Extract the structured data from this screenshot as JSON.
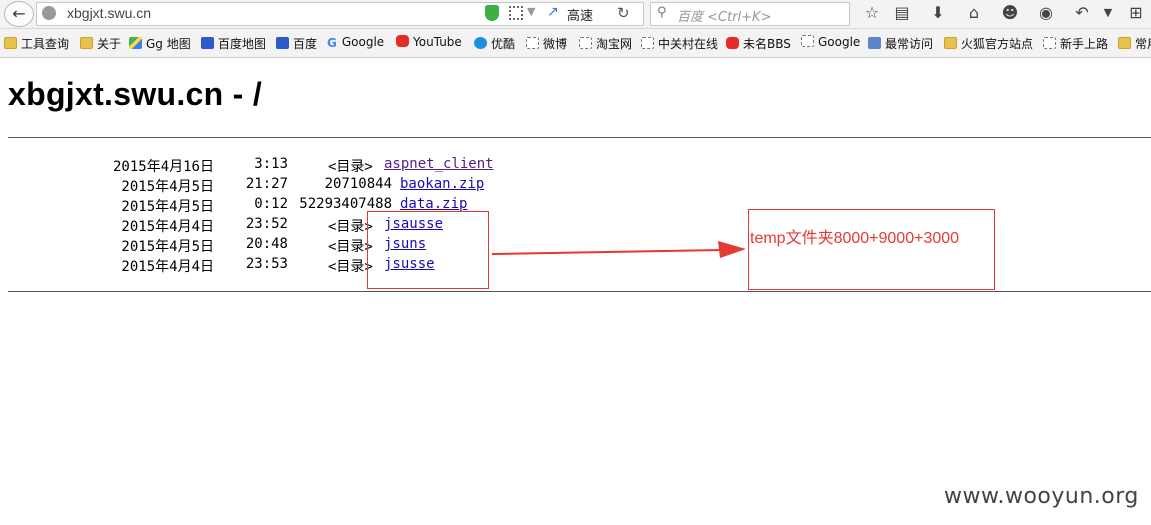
{
  "toolbar": {
    "url": "xbgjxt.swu.cn",
    "speed_label": "高速",
    "search_placeholder": "百度 <Ctrl+K>"
  },
  "bookmarks": [
    {
      "label": "工具查询",
      "icon": "folder"
    },
    {
      "label": "关于",
      "icon": "folder"
    },
    {
      "label": "Gg 地图",
      "icon": "maps"
    },
    {
      "label": "百度地图",
      "icon": "paw"
    },
    {
      "label": "百度",
      "icon": "paw"
    },
    {
      "label": "Google",
      "icon": "gg"
    },
    {
      "label": "YouTube",
      "icon": "yt"
    },
    {
      "label": "优酷",
      "icon": "yk"
    },
    {
      "label": "微博",
      "icon": "page"
    },
    {
      "label": "淘宝网",
      "icon": "page"
    },
    {
      "label": "中关村在线",
      "icon": "page"
    },
    {
      "label": "未名BBS",
      "icon": "yt"
    },
    {
      "label": "Google",
      "icon": "page"
    },
    {
      "label": "最常访问",
      "icon": "lens"
    },
    {
      "label": "火狐官方站点",
      "icon": "folder"
    },
    {
      "label": "新手上路",
      "icon": "page"
    },
    {
      "label": "常用",
      "icon": "folder"
    }
  ],
  "page": {
    "heading": "xbgjxt.swu.cn - /",
    "entries": [
      {
        "date": "2015年4月16日",
        "time": "3:13",
        "size": "<目录>",
        "name": "aspnet_client"
      },
      {
        "date": "2015年4月5日",
        "time": "21:27",
        "size": "20710844",
        "name": "baokan.zip"
      },
      {
        "date": "2015年4月5日",
        "time": "0:12",
        "size": "52293407488",
        "name": "data.zip"
      },
      {
        "date": "2015年4月4日",
        "time": "23:52",
        "size": "<目录>",
        "name": "jsausse"
      },
      {
        "date": "2015年4月5日",
        "time": "20:48",
        "size": "<目录>",
        "name": "jsuns"
      },
      {
        "date": "2015年4月4日",
        "time": "23:53",
        "size": "<目录>",
        "name": "jsusse"
      }
    ]
  },
  "annotation": {
    "note": "temp文件夹8000+9000+3000",
    "color": "#e53935"
  },
  "watermark": "www.wooyun.org"
}
